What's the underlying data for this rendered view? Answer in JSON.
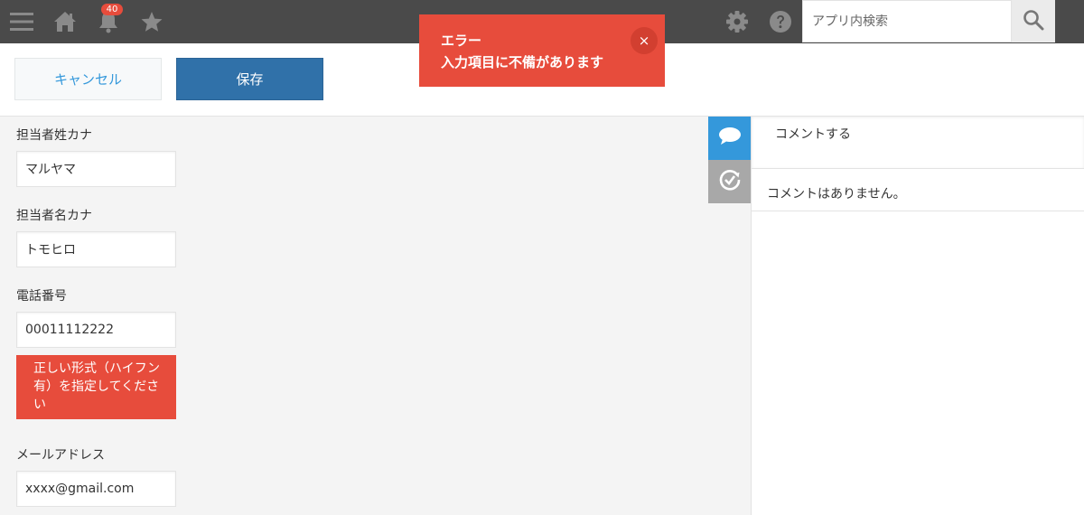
{
  "header": {
    "notification_count": "40",
    "search": {
      "placeholder": "アプリ内検索",
      "value": ""
    },
    "bg_color": "#4a4a4a",
    "icons": [
      "menu-icon",
      "home-icon",
      "bell-icon",
      "star-icon",
      "gear-icon",
      "help-icon",
      "search-icon"
    ]
  },
  "toolbar": {
    "cancel_label": "キャンセル",
    "save_label": "保存"
  },
  "toast": {
    "title": "エラー",
    "message": "入力項目に不備があります",
    "close_label": "×",
    "color": "#e74c3c"
  },
  "form": {
    "fields": [
      {
        "label": "担当者姓カナ",
        "value": "マルヤマ"
      },
      {
        "label": "担当者名カナ",
        "value": "トモヒロ"
      },
      {
        "label": "電話番号",
        "value": "00011112222",
        "error": "正しい形式（ハイフン有）を指定してください"
      },
      {
        "label": "メールアドレス",
        "value": "xxxx@gmail.com"
      }
    ]
  },
  "side_tabs": [
    {
      "icon": "comment-icon",
      "active": true,
      "color": "#3498db"
    },
    {
      "icon": "history-icon",
      "active": false,
      "color": "#a8a8a8"
    }
  ],
  "comments": {
    "placeholder": "コメントする",
    "empty_text": "コメントはありません。"
  }
}
